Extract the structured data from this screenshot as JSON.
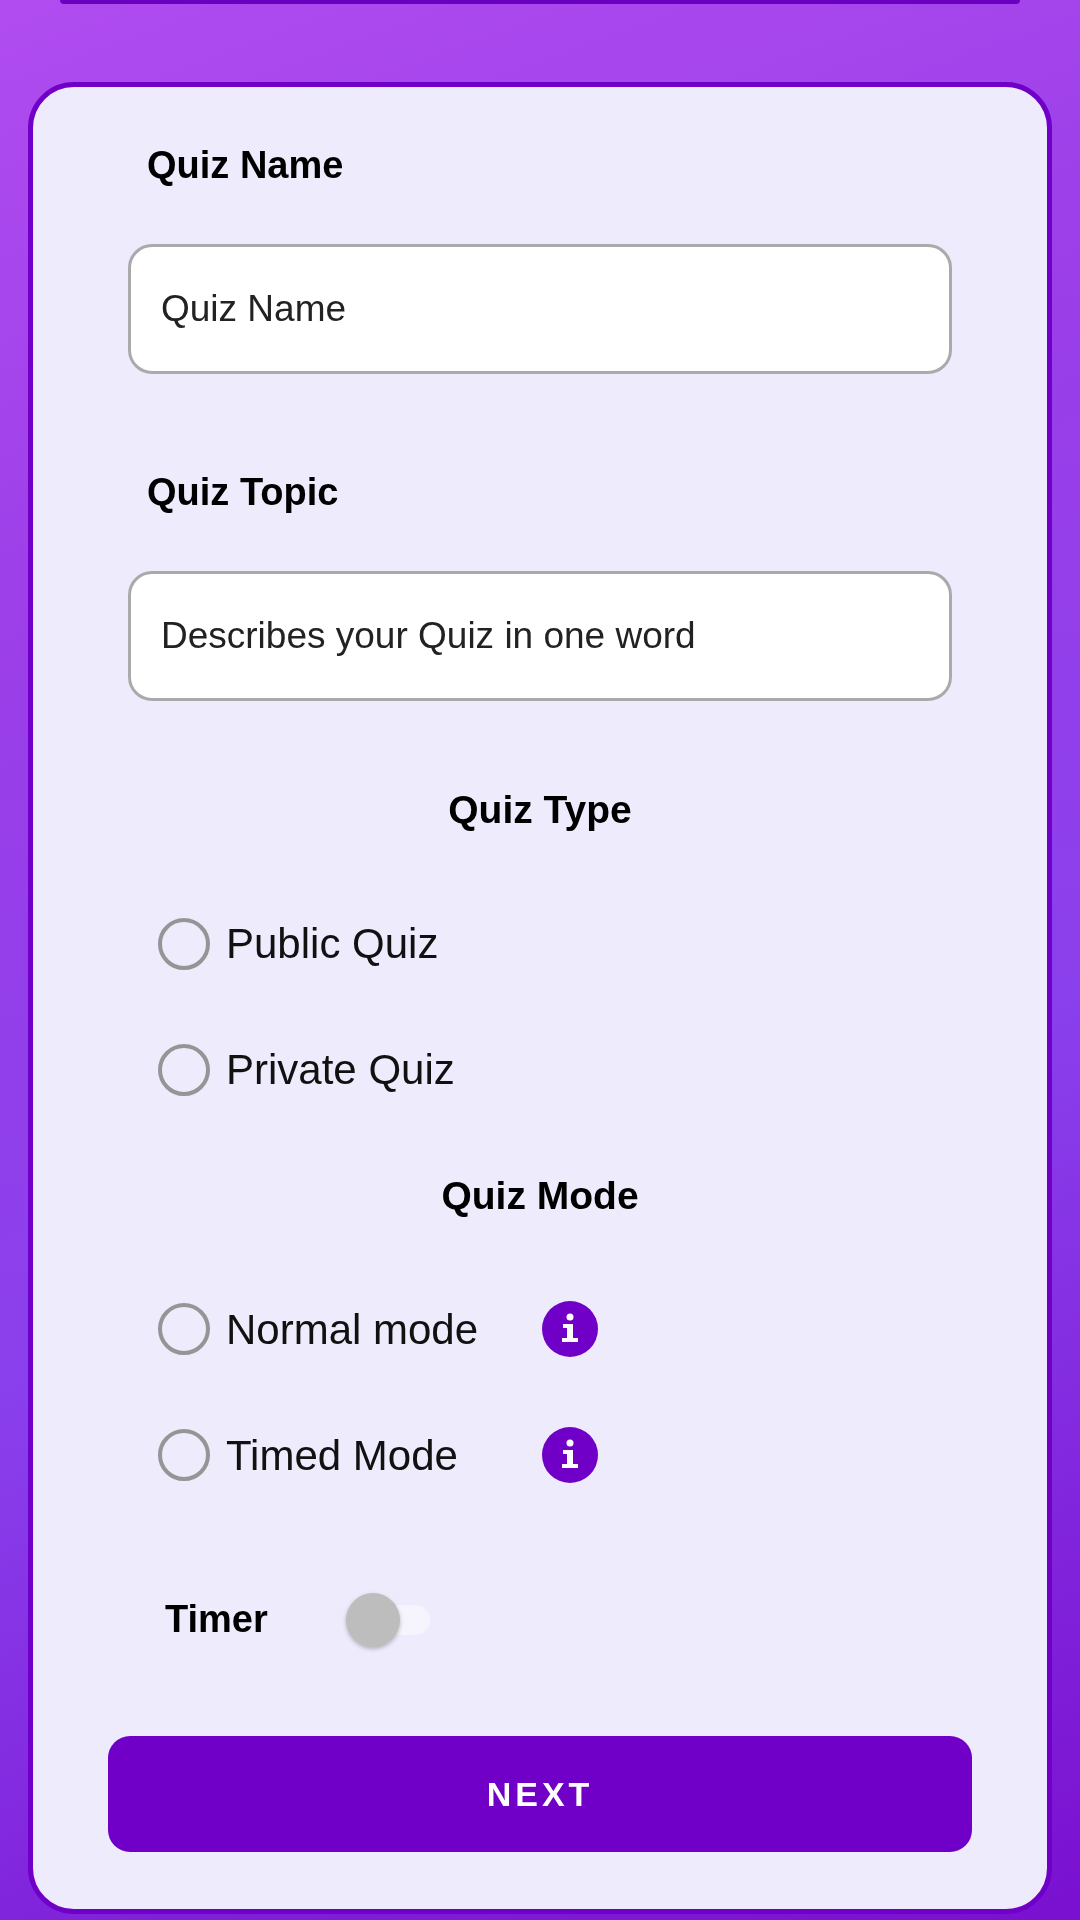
{
  "fields": [
    {
      "label": "Quiz Name",
      "placeholder": "Quiz Name"
    },
    {
      "label": "Quiz Topic",
      "placeholder": "Describes your Quiz in one word"
    }
  ],
  "quiz_type": {
    "title": "Quiz Type",
    "options": [
      {
        "label": "Public Quiz",
        "selected": false,
        "info": false
      },
      {
        "label": "Private Quiz",
        "selected": false,
        "info": false
      }
    ]
  },
  "quiz_mode": {
    "title": "Quiz Mode",
    "options": [
      {
        "label": "Normal mode",
        "selected": false,
        "info": true
      },
      {
        "label": "Timed Mode",
        "selected": false,
        "info": true
      }
    ]
  },
  "timer": {
    "label": "Timer",
    "on": false
  },
  "next_button": "NEXT"
}
